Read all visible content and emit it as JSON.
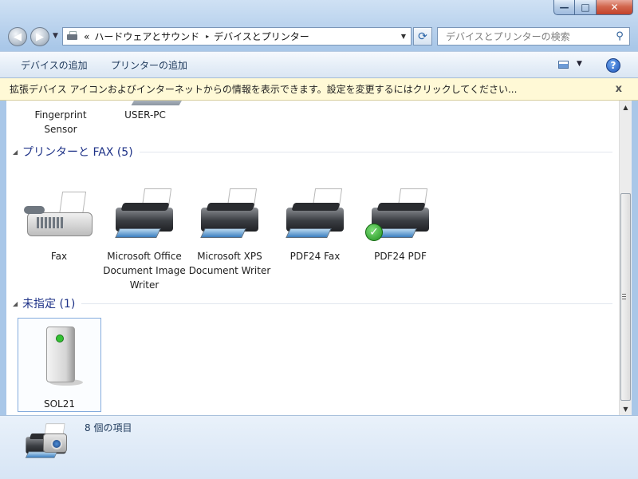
{
  "window": {
    "caption_buttons": {
      "minimize": "—",
      "maximize": "□",
      "close": "✕"
    }
  },
  "nav": {
    "back_icon": "back-arrow-icon",
    "forward_icon": "forward-arrow-icon",
    "breadcrumb_overflow": "«",
    "breadcrumb": [
      "ハードウェアとサウンド",
      "デバイスとプリンター"
    ],
    "breadcrumb_separator": "▸",
    "search_placeholder": "デバイスとプリンターの検索"
  },
  "toolbar": {
    "add_device": "デバイスの追加",
    "add_printer": "プリンターの追加",
    "help": "?"
  },
  "infobar": {
    "text": "拡張デバイス アイコンおよびインターネットからの情報を表示できます。設定を変更するにはクリックしてください...",
    "close": "x"
  },
  "partial_devices": [
    {
      "label": "Fingerprint Sensor"
    },
    {
      "label": "USER-PC"
    }
  ],
  "groups": [
    {
      "title": "プリンターと FAX (5)",
      "items": [
        {
          "label": "Fax",
          "icon": "fax-icon"
        },
        {
          "label": "Microsoft Office Document Image Writer",
          "icon": "printer-icon"
        },
        {
          "label": "Microsoft XPS Document Writer",
          "icon": "printer-icon"
        },
        {
          "label": "PDF24 Fax",
          "icon": "printer-icon"
        },
        {
          "label": "PDF24 PDF",
          "icon": "printer-icon",
          "default": true
        }
      ]
    },
    {
      "title": "未指定 (1)",
      "items": [
        {
          "label": "SOL21",
          "icon": "server-icon",
          "selected": true
        }
      ]
    }
  ],
  "details": {
    "count_text": "8 個の項目"
  }
}
